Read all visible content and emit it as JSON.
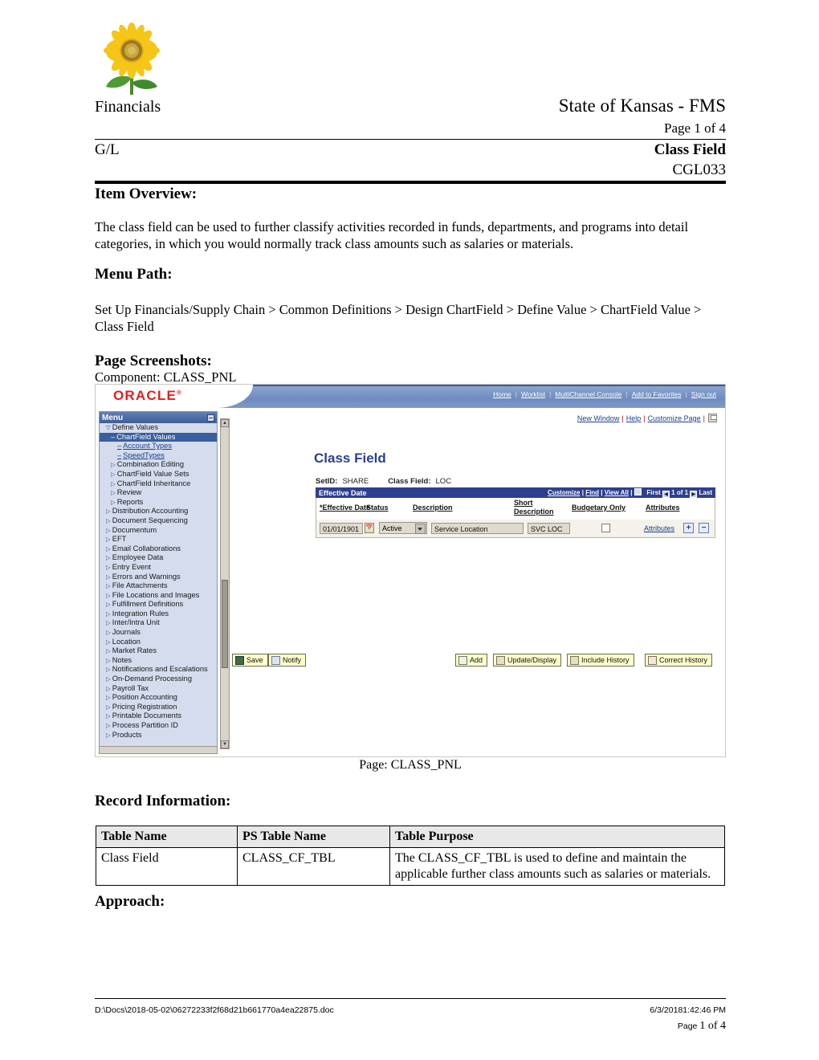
{
  "header": {
    "logo": "sunflower-logo",
    "left_title": "Financials",
    "org_title": "State of Kansas - FMS",
    "page_label": "Page 1 of 4",
    "module": "G/L",
    "doc_title": "Class Field",
    "doc_code": "CGL033"
  },
  "sections": {
    "item_overview_heading": "Item Overview:",
    "item_overview_body": "The class field can be used to further classify activities recorded in funds, departments, and programs into detail categories, in which you would normally track class amounts such as salaries or materials.",
    "menu_path_heading": "Menu Path:",
    "menu_path_body": "Set Up Financials/Supply Chain > Common Definitions > Design ChartField > Define Value > ChartField Value > Class Field",
    "page_screenshots_heading": "Page Screenshots:",
    "component_label": "Component:   CLASS_PNL",
    "page_caption": "Page:  CLASS_PNL",
    "record_information_heading": "Record Information:",
    "approach_heading": "Approach:"
  },
  "screenshot": {
    "brand": "ORACLE",
    "brand_mark": "®",
    "toplinks": [
      "Home",
      "Worklist",
      "MultiChannel Console",
      "Add to Favorites",
      "Sign out"
    ],
    "windowlinks": [
      "New Window",
      "Help",
      "Customize Page"
    ],
    "print_icon": "print-icon",
    "menu": {
      "header": "Menu",
      "collapse_icon": "collapse-icon",
      "items": [
        {
          "label": "Define Values",
          "indent": 1,
          "marker": "expanded",
          "style": "plain"
        },
        {
          "label": "ChartField Values",
          "indent": 2,
          "marker": "dash",
          "style": "selected"
        },
        {
          "label": "Account Types",
          "indent": 3,
          "marker": "dash",
          "style": "link"
        },
        {
          "label": "SpeedTypes",
          "indent": 3,
          "marker": "dash",
          "style": "link"
        },
        {
          "label": "Combination Editing",
          "indent": 2,
          "marker": "collapsed",
          "style": "plain"
        },
        {
          "label": "ChartField Value Sets",
          "indent": 2,
          "marker": "collapsed",
          "style": "plain"
        },
        {
          "label": "ChartField Inheritance",
          "indent": 2,
          "marker": "collapsed",
          "style": "plain"
        },
        {
          "label": "Review",
          "indent": 2,
          "marker": "collapsed",
          "style": "plain"
        },
        {
          "label": "Reports",
          "indent": 2,
          "marker": "collapsed",
          "style": "plain"
        },
        {
          "label": "Distribution Accounting",
          "indent": 1,
          "marker": "collapsed",
          "style": "plain"
        },
        {
          "label": "Document Sequencing",
          "indent": 1,
          "marker": "collapsed",
          "style": "plain"
        },
        {
          "label": "Documentum",
          "indent": 1,
          "marker": "collapsed",
          "style": "plain"
        },
        {
          "label": "EFT",
          "indent": 1,
          "marker": "collapsed",
          "style": "plain"
        },
        {
          "label": "Email Collaborations",
          "indent": 1,
          "marker": "collapsed",
          "style": "plain"
        },
        {
          "label": "Employee Data",
          "indent": 1,
          "marker": "collapsed",
          "style": "plain"
        },
        {
          "label": "Entry Event",
          "indent": 1,
          "marker": "collapsed",
          "style": "plain"
        },
        {
          "label": "Errors and Warnings",
          "indent": 1,
          "marker": "collapsed",
          "style": "plain"
        },
        {
          "label": "File Attachments",
          "indent": 1,
          "marker": "collapsed",
          "style": "plain"
        },
        {
          "label": "File Locations and Images",
          "indent": 1,
          "marker": "collapsed",
          "style": "wrap"
        },
        {
          "label": "Fulfillment Definitions",
          "indent": 1,
          "marker": "collapsed",
          "style": "plain"
        },
        {
          "label": "Integration Rules",
          "indent": 1,
          "marker": "collapsed",
          "style": "plain"
        },
        {
          "label": "Inter/Intra Unit",
          "indent": 1,
          "marker": "collapsed",
          "style": "plain"
        },
        {
          "label": "Journals",
          "indent": 1,
          "marker": "collapsed",
          "style": "plain"
        },
        {
          "label": "Location",
          "indent": 1,
          "marker": "collapsed",
          "style": "plain"
        },
        {
          "label": "Market Rates",
          "indent": 1,
          "marker": "collapsed",
          "style": "plain"
        },
        {
          "label": "Notes",
          "indent": 1,
          "marker": "collapsed",
          "style": "plain"
        },
        {
          "label": "Notifications and Escalations",
          "indent": 1,
          "marker": "collapsed",
          "style": "wrap"
        },
        {
          "label": "On-Demand Processing",
          "indent": 1,
          "marker": "collapsed",
          "style": "plain"
        },
        {
          "label": "Payroll Tax",
          "indent": 1,
          "marker": "collapsed",
          "style": "plain"
        },
        {
          "label": "Position Accounting",
          "indent": 1,
          "marker": "collapsed",
          "style": "plain"
        },
        {
          "label": "Pricing Registration",
          "indent": 1,
          "marker": "collapsed",
          "style": "plain"
        },
        {
          "label": "Printable Documents",
          "indent": 1,
          "marker": "collapsed",
          "style": "plain"
        },
        {
          "label": "Process Partition ID",
          "indent": 1,
          "marker": "collapsed",
          "style": "plain"
        },
        {
          "label": "Products",
          "indent": 1,
          "marker": "collapsed",
          "style": "plain"
        }
      ]
    },
    "page_title": "Class Field",
    "keys": {
      "setid_label": "SetID:",
      "setid_value": "SHARE",
      "classfield_label": "Class Field:",
      "classfield_value": "LOC"
    },
    "grid": {
      "title": "Effective Date",
      "customize": "Customize",
      "find": "Find",
      "view_all": "View All",
      "grid_icon": "grid-icon",
      "first": "First",
      "prev_icon": "prev-arrow-icon",
      "counter": "1 of 1",
      "next_icon": "next-arrow-icon",
      "last": "Last",
      "columns": [
        "*Effective Date",
        "Status",
        "Description",
        "Short Description",
        "Budgetary Only",
        "Attributes"
      ],
      "row": {
        "effective_date": "01/01/1901",
        "calendar_icon": "calendar-icon",
        "status": "Active",
        "description": "Service Location",
        "short_description": "SVC LOC",
        "budgetary_only_checked": false,
        "attributes_link": "Attributes",
        "add_row_icon": "plus-icon",
        "delete_row_icon": "minus-icon"
      }
    },
    "buttons": {
      "save": "Save",
      "notify": "Notify",
      "add": "Add",
      "update_display": "Update/Display",
      "include_history": "Include History",
      "correct_history": "Correct History"
    }
  },
  "record_table": {
    "headers": [
      "Table Name",
      "PS Table Name",
      "Table Purpose"
    ],
    "rows": [
      [
        "Class Field",
        "CLASS_CF_TBL",
        "The CLASS_CF_TBL is used to define and maintain the applicable further class amounts such as salaries or materials."
      ]
    ]
  },
  "footer": {
    "path": "D:\\Docs\\2018-05-02\\06272233f2f68d21b661770a4ea22875.doc",
    "timestamp": "6/3/20181:42:46 PM",
    "page_prefix": "Page ",
    "page_number": "1",
    "page_of": " of ",
    "page_total": "4"
  },
  "colors": {
    "oracle_red": "#e02020",
    "ps_blue": "#6e8cbf",
    "grid_header_blue": "#2f3f8f",
    "selected_menu": "#3a5e9e",
    "button_yellow": "#ffffcc"
  }
}
